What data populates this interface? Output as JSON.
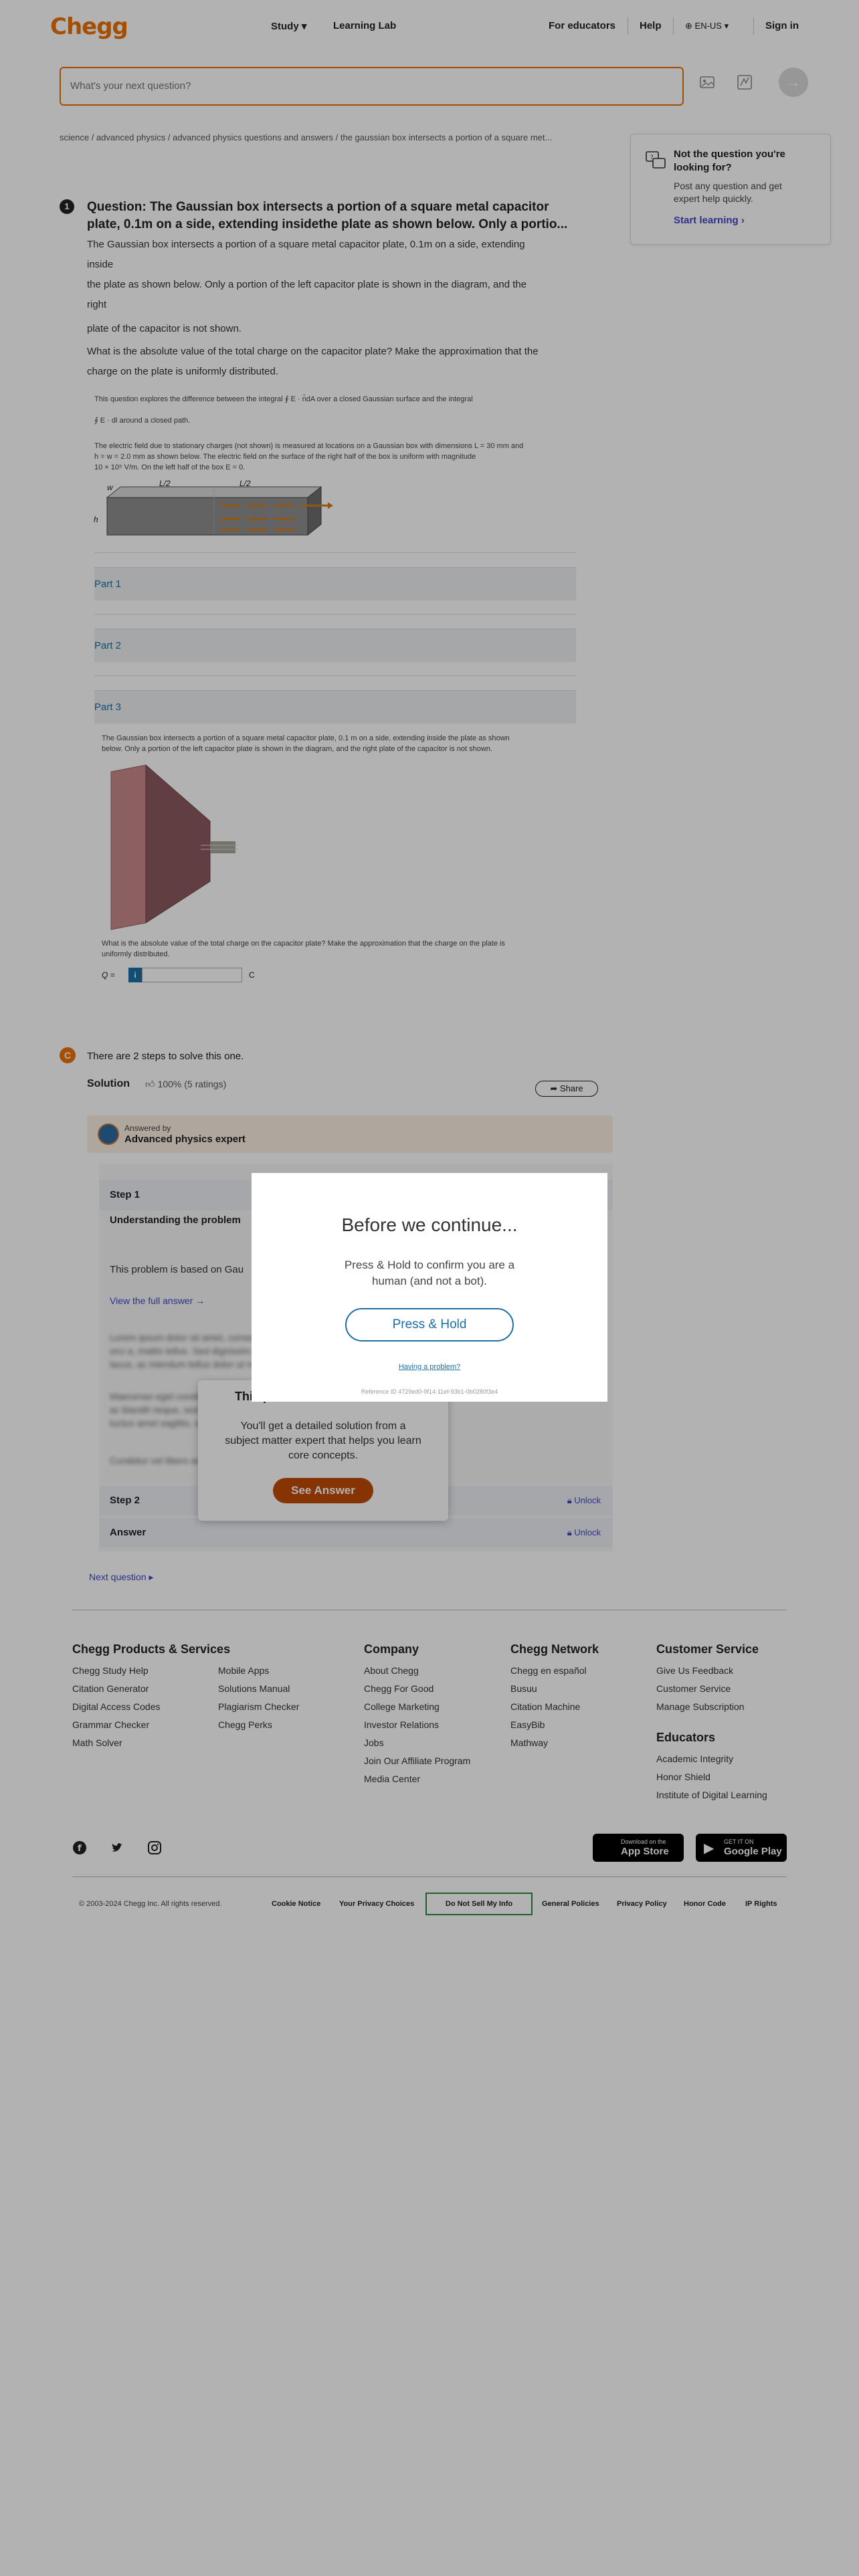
{
  "header": {
    "logo": "Chegg",
    "nav_study": "Study",
    "nav_lab": "Learning Lab",
    "nav_educators": "For educators",
    "nav_help": "Help",
    "nav_lang": "EN-US",
    "nav_signin": "Sign in"
  },
  "search": {
    "placeholder": "What's your next question?"
  },
  "breadcrumb": "science / advanced physics / advanced physics questions and answers / the gaussian box intersects a portion of a square met...",
  "side_card": {
    "title": "Not the question you're looking for?",
    "text": "Post any question and get expert help quickly.",
    "link": "Start learning"
  },
  "question": {
    "number": "1",
    "title": "Question: The Gaussian box intersects a portion of a square metal capacitor plate, 0.1m on a side, extending insidethe plate as shown below. Only a portio...",
    "lines": [
      "The Gaussian box intersects a portion of a square metal capacitor plate, 0.1m on a side, extending",
      "inside",
      "the plate as shown below. Only a portion of the left capacitor plate is shown in the diagram, and the",
      "right",
      "plate of the capacitor is not shown.",
      "What is the absolute value of the total charge on the capacitor plate? Make the approximation that the",
      "charge on the plate is uniformly distributed."
    ],
    "figure_text_1": "This question explores the difference between the integral ∮ E · n̂dA over a closed Gaussian surface and the integral",
    "figure_text_2": "∮ E · dl around a closed path.",
    "figure_text_3": "The electric field due to stationary charges (not shown) is measured at locations on a Gaussian box with dimensions L = 30 mm and",
    "figure_text_4": "h = w = 2.0 mm as shown below. The electric field on the surface of the right half of the box is uniform with magnitude",
    "figure_text_5": "10 × 10⁵ V/m. On the left half of the box E = 0.",
    "diagram_labels": {
      "w": "w",
      "l1": "L/2",
      "l2": "L/2",
      "h": "h"
    },
    "parts": [
      "Part 1",
      "Part 2",
      "Part 3"
    ],
    "part3_text_1": "The Gaussian box intersects a portion of a square metal capacitor plate, 0.1 m on a side, extending inside the plate as shown",
    "part3_text_2": "below. Only a portion of the left capacitor plate is shown in the diagram, and the right plate of the capacitor is not shown.",
    "part3_q_1": "What is the absolute value of the total charge on the capacitor plate? Make the approximation that the charge on the plate is",
    "part3_q_2": "uniformly distributed.",
    "answer_label": "Q =",
    "answer_info": "i",
    "answer_unit": "C"
  },
  "solution": {
    "badge": "C",
    "steps_text": "There are 2 steps to solve this one.",
    "label": "Solution",
    "rating": "100% (5 ratings)",
    "share": "Share",
    "answered_by": "Answered by",
    "expert": "Advanced physics expert",
    "step1": "Step 1",
    "step1_sub": "Understanding the problem",
    "step1_text": "This problem is based on Gau",
    "full_answer": "View the full answer →",
    "blur_lines": [
      "Lorem ipsum dolor sit amet, consectetur adipiscing elit, sed do eiusmod",
      "orci a, mattis tellus. Sed dignissim, metus nec fringilla accumsan, risus",
      "lacus, ac interdum tellus dolor ut nisl.",
      "Maecenas eget condimentum velit, sit amet feugiat lectus. Aenean",
      "ac blandit neque, sed consequat ut magna vitae, vel suscipit",
      "luctus amet sagittis, sodales tellus non.",
      "Curabitur vel libero at ligula ornare pulvinar, ut tempus ante."
    ],
    "blur_card_title": "This problem has been solved!",
    "blur_card_text": "You'll get a detailed solution from a subject matter expert that helps you learn core concepts.",
    "see_answer": "See Answer",
    "step2": "Step 2",
    "answer": "Answer",
    "unlock": "Unlock",
    "next": "Next question"
  },
  "footer": {
    "col1_title": "Chegg Products & Services",
    "col1a": [
      "Chegg Study Help",
      "Citation Generator",
      "Digital Access Codes",
      "Grammar Checker",
      "Math Solver"
    ],
    "col1b": [
      "Mobile Apps",
      "Solutions Manual",
      "Plagiarism Checker",
      "Chegg Perks"
    ],
    "col2_title": "Company",
    "col2": [
      "About Chegg",
      "Chegg For Good",
      "College Marketing",
      "Investor Relations",
      "Jobs",
      "Join Our Affiliate Program",
      "Media Center"
    ],
    "col3_title": "Chegg Network",
    "col3": [
      "Chegg en español",
      "Busuu",
      "Citation Machine",
      "EasyBib",
      "Mathway"
    ],
    "col4_title": "Customer Service",
    "col4": [
      "Give Us Feedback",
      "Customer Service",
      "Manage Subscription"
    ],
    "col5_title": "Educators",
    "col5": [
      "Academic Integrity",
      "Honor Shield",
      "Institute of Digital Learning"
    ],
    "app_store_small": "Download on the",
    "app_store_big": "App Store",
    "play_small": "GET IT ON",
    "play_big": "Google Play",
    "copyright": "© 2003-2024 Chegg Inc. All rights reserved.",
    "legal": [
      "Cookie Notice",
      "Your Privacy Choices",
      "Do Not Sell My Info",
      "General Policies",
      "Privacy Policy",
      "Honor Code",
      "IP Rights"
    ]
  },
  "modal": {
    "title": "Before we continue...",
    "subtitle": "Press & Hold to confirm you are a human (and not a bot).",
    "button": "Press & Hold",
    "problem": "Having a problem?",
    "reference": "Reference ID 4729ed0-9f14-11ef-93b1-0b0280f3e4"
  },
  "colors": {
    "brand": "#eb7100",
    "link": "#3e46c7",
    "modal_accent": "#1d6fa5"
  }
}
